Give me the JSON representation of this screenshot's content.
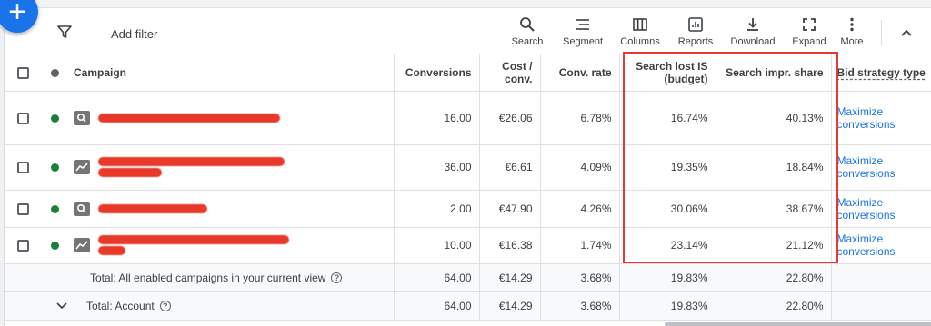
{
  "fab": {
    "label": "+"
  },
  "toolbar": {
    "add_filter": "Add filter",
    "tools": [
      {
        "label": "Search",
        "icon": "search-icon"
      },
      {
        "label": "Segment",
        "icon": "segment-icon"
      },
      {
        "label": "Columns",
        "icon": "columns-icon"
      },
      {
        "label": "Reports",
        "icon": "reports-icon"
      },
      {
        "label": "Download",
        "icon": "download-icon"
      },
      {
        "label": "Expand",
        "icon": "expand-icon"
      },
      {
        "label": "More",
        "icon": "more-icon"
      }
    ]
  },
  "table": {
    "headers": {
      "campaign": "Campaign",
      "conversions": "Conversions",
      "cost_conv_1": "Cost /",
      "cost_conv_2": "conv.",
      "conv_rate": "Conv. rate",
      "lost_is_1": "Search lost IS",
      "lost_is_2": "(budget)",
      "impr_share": "Search impr. share",
      "bid_strategy": "Bid strategy type"
    },
    "rows": [
      {
        "status": "enabled",
        "type_icon": "search-campaign-icon",
        "conversions": "16.00",
        "cost_conv": "€26.06",
        "conv_rate": "6.78%",
        "lost_is": "16.74%",
        "impr_share": "40.13%",
        "bid_1": "Maximize",
        "bid_2": "conversions"
      },
      {
        "status": "enabled",
        "type_icon": "performance-campaign-icon",
        "conversions": "36.00",
        "cost_conv": "€6.61",
        "conv_rate": "4.09%",
        "lost_is": "19.35%",
        "impr_share": "18.84%",
        "bid_1": "Maximize",
        "bid_2": "conversions"
      },
      {
        "status": "enabled",
        "type_icon": "search-campaign-icon",
        "conversions": "2.00",
        "cost_conv": "€47.90",
        "conv_rate": "4.26%",
        "lost_is": "30.06%",
        "impr_share": "38.67%",
        "bid_1": "Maximize",
        "bid_2": "conversions"
      },
      {
        "status": "enabled",
        "type_icon": "performance-campaign-icon",
        "conversions": "10.00",
        "cost_conv": "€16.38",
        "conv_rate": "1.74%",
        "lost_is": "23.14%",
        "impr_share": "21.12%",
        "bid_1": "Maximize",
        "bid_2": "conversions"
      }
    ],
    "totals": [
      {
        "label": "Total: All enabled campaigns in your current view",
        "conversions": "64.00",
        "cost_conv": "€14.29",
        "conv_rate": "3.68%",
        "lost_is": "19.83%",
        "impr_share": "22.80%"
      },
      {
        "label": "Total: Account",
        "conversions": "64.00",
        "cost_conv": "€14.29",
        "conv_rate": "3.68%",
        "lost_is": "19.83%",
        "impr_share": "22.80%"
      }
    ]
  },
  "colors": {
    "accent": "#1a73e8",
    "status_enabled": "#188038",
    "highlight_box": "#e53935",
    "redaction": "#e8392b"
  }
}
